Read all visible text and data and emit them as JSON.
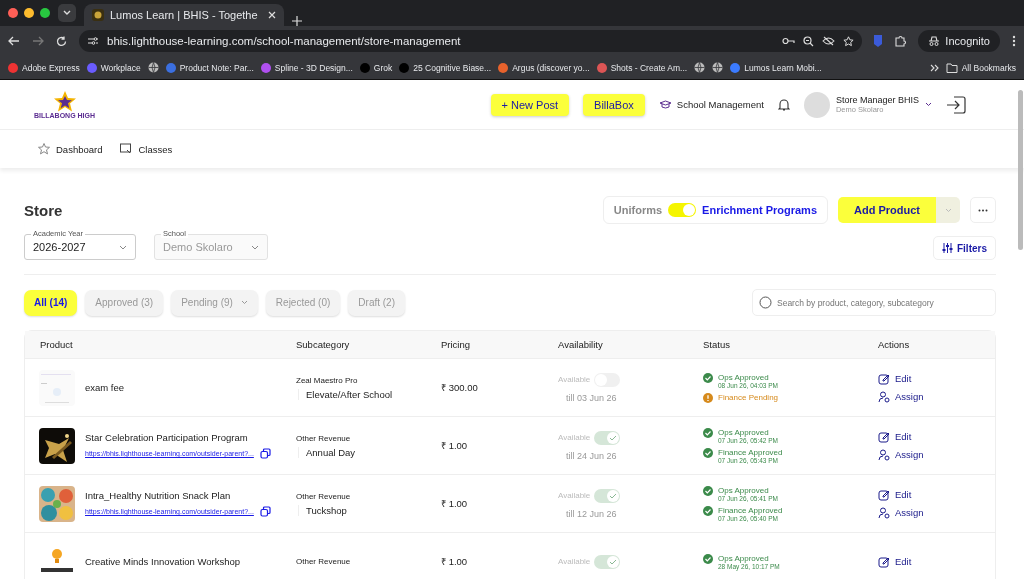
{
  "browser": {
    "tab_title": "Lumos Learn | BHIS - Togethe",
    "url": "bhis.lighthouse-learning.com/school-management/store-management",
    "profile": "Incognito",
    "bookmarks": [
      {
        "kind": "link",
        "label": "Adobe Express"
      },
      {
        "kind": "link",
        "label": "Workplace"
      },
      {
        "kind": "icon"
      },
      {
        "kind": "link",
        "label": "Product Note: Par..."
      },
      {
        "kind": "link",
        "label": "Spline - 3D Design..."
      },
      {
        "kind": "link",
        "label": "Grok"
      },
      {
        "kind": "link",
        "label": "25 Cognitive Biase..."
      },
      {
        "kind": "link",
        "label": "Argus (discover yo..."
      },
      {
        "kind": "link",
        "label": "Shots - Create Am..."
      },
      {
        "kind": "icon"
      },
      {
        "kind": "icon"
      },
      {
        "kind": "link",
        "label": "Lumos Learn Mobi..."
      }
    ],
    "all_bookmarks": "All Bookmarks"
  },
  "header": {
    "logo_text": "BILLABONG HIGH",
    "buttons": [
      "+ New Post",
      "BillaBox"
    ],
    "school_management": "School Management",
    "user_name": "Store Manager BHIS",
    "user_subtitle": "Demo Skolaro"
  },
  "nav": [
    {
      "label": "Dashboard"
    },
    {
      "label": "Classes"
    }
  ],
  "store": {
    "title": "Store",
    "toggle": {
      "left": "Uniforms",
      "right": "Enrichment Programs",
      "on": true
    },
    "add_product": "Add Product",
    "filters": [
      {
        "label": "Academic Year",
        "value": "2026-2027",
        "disabled": false
      },
      {
        "label": "School",
        "value": "Demo Skolaro",
        "disabled": true
      }
    ],
    "filters_button": "Filters",
    "status_tabs": [
      {
        "label": "All (14)",
        "selected": true,
        "has_menu": false
      },
      {
        "label": "Approved (3)",
        "selected": false,
        "has_menu": false
      },
      {
        "label": "Pending (9)",
        "selected": false,
        "has_menu": true
      },
      {
        "label": "Rejected (0)",
        "selected": false,
        "has_menu": false
      },
      {
        "label": "Draft (2)",
        "selected": false,
        "has_menu": false
      }
    ],
    "search": {
      "placeholder": "Search by product, category, subcategory"
    }
  },
  "table": {
    "columns": [
      "Product",
      "Subcategory",
      "Pricing",
      "Availability",
      "Status",
      "Actions"
    ],
    "rows": [
      {
        "name": "exam fee",
        "category": "Zeal Maestro Pro",
        "subcategory": "Elevate/After School",
        "price": "₹ 300.00",
        "availability": "Available",
        "available": false,
        "till": "till 03 Jun 26",
        "status": [
          {
            "label": "Ops Approved",
            "time": "08 Jun 26, 04:03 PM",
            "kind": "approved"
          },
          {
            "label": "Finance Pending",
            "kind": "pending"
          }
        ],
        "actions": [
          "Edit",
          "Assign"
        ]
      },
      {
        "name": "Star Celebration Participation Program",
        "link": "https://bhis.lighthouse-learning.com/outsider-parent?...",
        "category": "Other Revenue",
        "subcategory": "Annual Day",
        "price": "₹ 1.00",
        "availability": "Available",
        "available": true,
        "till": "till 24 Jun 26",
        "status": [
          {
            "label": "Ops Approved",
            "time": "07 Jun 26, 05:42 PM",
            "kind": "approved"
          },
          {
            "label": "Finance Approved",
            "time": "07 Jun 26, 05:43 PM",
            "kind": "approved"
          }
        ],
        "actions": [
          "Edit",
          "Assign"
        ]
      },
      {
        "name": "Intra_Healthy Nutrition Snack Plan",
        "link": "https://bhis.lighthouse-learning.com/outsider-parent?...",
        "category": "Other Revenue",
        "subcategory": "Tuckshop",
        "price": "₹ 1.00",
        "availability": "Available",
        "available": true,
        "till": "till 12 Jun 26",
        "status": [
          {
            "label": "Ops Approved",
            "time": "07 Jun 26, 05:41 PM",
            "kind": "approved"
          },
          {
            "label": "Finance Approved",
            "time": "07 Jun 26, 05:40 PM",
            "kind": "approved"
          }
        ],
        "actions": [
          "Edit",
          "Assign"
        ]
      },
      {
        "name": "Creative Minds Innovation Workshop",
        "category": "Other Revenue",
        "price": "₹ 1.00",
        "availability": "Available",
        "available": true,
        "status": [
          {
            "label": "Ops Approved",
            "time": "28 May 26, 10:17 PM",
            "kind": "approved"
          }
        ],
        "actions": [
          "Edit"
        ]
      }
    ]
  }
}
